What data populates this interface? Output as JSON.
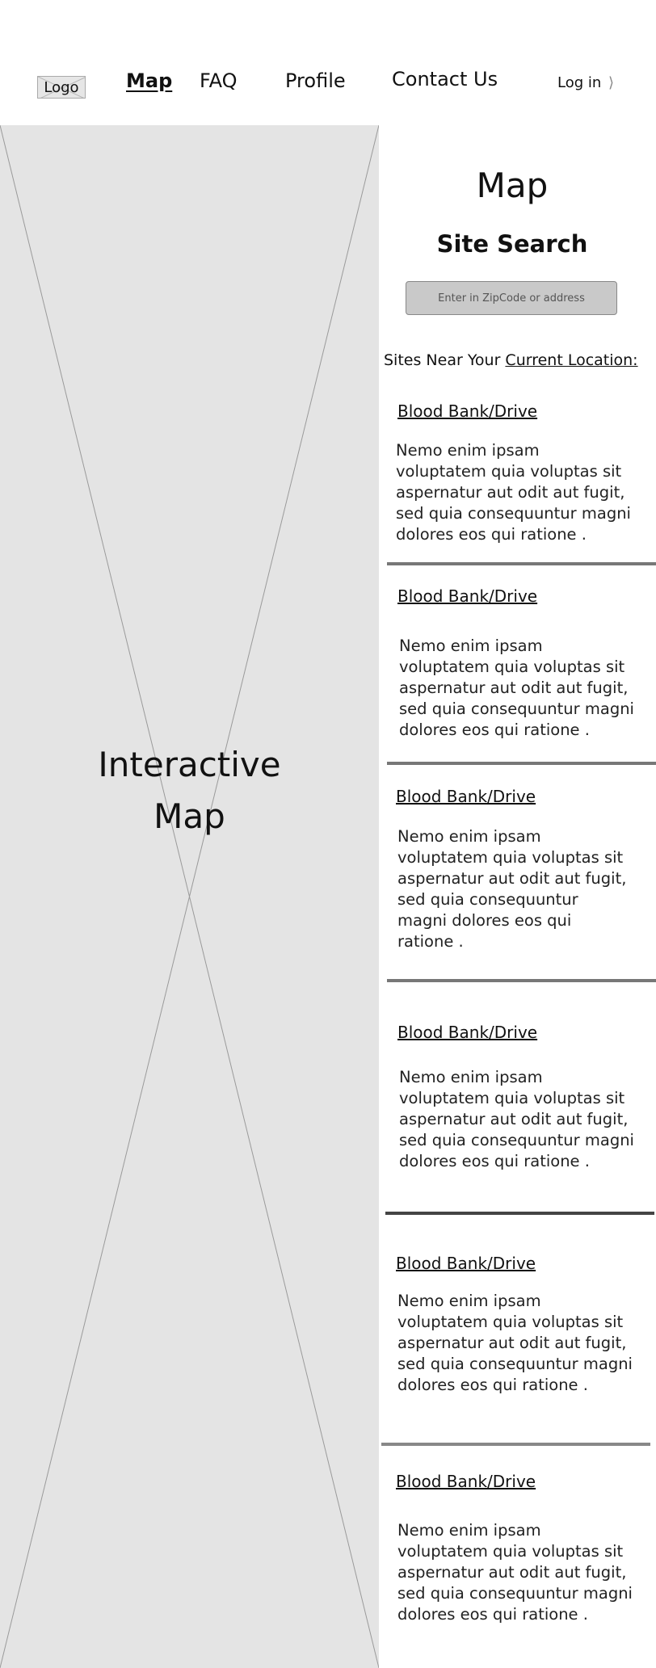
{
  "nav": {
    "logo": "Logo",
    "items": [
      {
        "label": "Map",
        "active": true
      },
      {
        "label": "FAQ",
        "active": false
      },
      {
        "label": "Profile",
        "active": false
      },
      {
        "label": "Contact Us",
        "active": false
      }
    ],
    "login": "Log in"
  },
  "map_panel": {
    "label_line1": "Interactive",
    "label_line2": "Map"
  },
  "sidebar": {
    "title": "Map",
    "search_title": "Site Search",
    "search_placeholder": "Enter in ZipCode or address",
    "near_prefix": "Sites Near Your ",
    "near_link": "Current Location:",
    "sites": [
      {
        "title": "Blood Bank/Drive",
        "lines": [
          "Nemo enim ipsam",
          "voluptatem quia voluptas sit",
          "aspernatur aut odit aut fugit,",
          "sed quia consequuntur magni",
          "dolores eos qui ratione ."
        ]
      },
      {
        "title": "Blood Bank/Drive",
        "lines": [
          "Nemo enim ipsam",
          "voluptatem quia voluptas sit",
          "aspernatur aut odit aut fugit,",
          "sed quia consequuntur magni",
          "dolores eos qui ratione ."
        ]
      },
      {
        "title": "Blood Bank/Drive",
        "lines": [
          "Nemo enim ipsam",
          "voluptatem quia voluptas sit",
          "aspernatur aut odit aut fugit,",
          "sed quia consequuntur",
          "magni dolores eos qui",
          "ratione ."
        ]
      },
      {
        "title": "Blood Bank/Drive",
        "lines": [
          "Nemo enim ipsam",
          "voluptatem quia voluptas sit",
          "aspernatur aut odit aut fugit,",
          "sed quia consequuntur magni",
          "dolores eos qui ratione ."
        ]
      },
      {
        "title": "Blood Bank/Drive",
        "lines": [
          "Nemo enim ipsam",
          "voluptatem quia voluptas sit",
          "aspernatur aut odit aut fugit,",
          "sed quia consequuntur magni",
          "dolores eos qui ratione ."
        ]
      },
      {
        "title": "Blood Bank/Drive",
        "lines": [
          "Nemo enim ipsam",
          "voluptatem quia voluptas sit",
          "aspernatur aut odit aut fugit,",
          "sed quia consequuntur magni",
          "dolores eos qui ratione ."
        ]
      }
    ]
  }
}
